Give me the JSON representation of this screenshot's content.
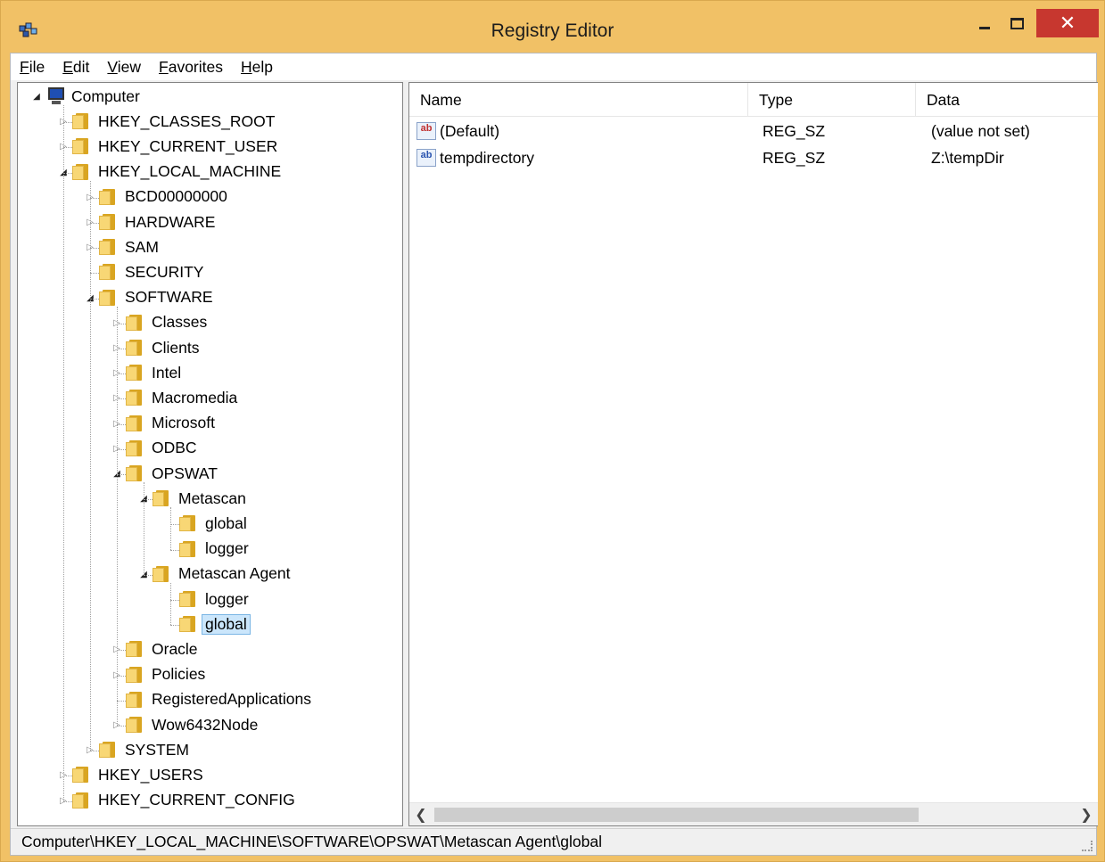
{
  "window": {
    "title": "Registry Editor"
  },
  "menu": [
    "File",
    "Edit",
    "View",
    "Favorites",
    "Help"
  ],
  "tree": [
    {
      "label": "Computer",
      "depth": 0,
      "state": "open",
      "icon": "computer-icon"
    },
    {
      "label": "HKEY_CLASSES_ROOT",
      "depth": 1,
      "state": "closed"
    },
    {
      "label": "HKEY_CURRENT_USER",
      "depth": 1,
      "state": "closed"
    },
    {
      "label": "HKEY_LOCAL_MACHINE",
      "depth": 1,
      "state": "open"
    },
    {
      "label": "BCD00000000",
      "depth": 2,
      "state": "closed"
    },
    {
      "label": "HARDWARE",
      "depth": 2,
      "state": "closed"
    },
    {
      "label": "SAM",
      "depth": 2,
      "state": "closed"
    },
    {
      "label": "SECURITY",
      "depth": 2,
      "state": "leaf"
    },
    {
      "label": "SOFTWARE",
      "depth": 2,
      "state": "open"
    },
    {
      "label": "Classes",
      "depth": 3,
      "state": "closed"
    },
    {
      "label": "Clients",
      "depth": 3,
      "state": "closed"
    },
    {
      "label": "Intel",
      "depth": 3,
      "state": "closed"
    },
    {
      "label": "Macromedia",
      "depth": 3,
      "state": "closed"
    },
    {
      "label": "Microsoft",
      "depth": 3,
      "state": "closed"
    },
    {
      "label": "ODBC",
      "depth": 3,
      "state": "closed"
    },
    {
      "label": "OPSWAT",
      "depth": 3,
      "state": "open"
    },
    {
      "label": "Metascan",
      "depth": 4,
      "state": "open"
    },
    {
      "label": "global",
      "depth": 5,
      "state": "leaf"
    },
    {
      "label": "logger",
      "depth": 5,
      "state": "leaf"
    },
    {
      "label": "Metascan Agent",
      "depth": 4,
      "state": "open"
    },
    {
      "label": "logger",
      "depth": 5,
      "state": "leaf"
    },
    {
      "label": "global",
      "depth": 5,
      "state": "leaf",
      "selected": true
    },
    {
      "label": "Oracle",
      "depth": 3,
      "state": "closed"
    },
    {
      "label": "Policies",
      "depth": 3,
      "state": "closed"
    },
    {
      "label": "RegisteredApplications",
      "depth": 3,
      "state": "leaf"
    },
    {
      "label": "Wow6432Node",
      "depth": 3,
      "state": "closed"
    },
    {
      "label": "SYSTEM",
      "depth": 2,
      "state": "closed"
    },
    {
      "label": "HKEY_USERS",
      "depth": 1,
      "state": "closed"
    },
    {
      "label": "HKEY_CURRENT_CONFIG",
      "depth": 1,
      "state": "closed"
    }
  ],
  "list": {
    "columns": [
      "Name",
      "Type",
      "Data"
    ],
    "rows": [
      {
        "name": "(Default)",
        "type": "REG_SZ",
        "data": "(value not set)",
        "icon": "string-value-icon",
        "iconText": "ab"
      },
      {
        "name": "tempdirectory",
        "type": "REG_SZ",
        "data": "Z:\\tempDir",
        "icon": "string-value-icon",
        "iconText": "ab"
      }
    ]
  },
  "status": {
    "path": "Computer\\HKEY_LOCAL_MACHINE\\SOFTWARE\\OPSWAT\\Metascan Agent\\global"
  },
  "colors": {
    "titlebar": "#f1c166",
    "close": "#c7372f",
    "selection": "#cbe6fb",
    "folder": "#f8d775"
  }
}
